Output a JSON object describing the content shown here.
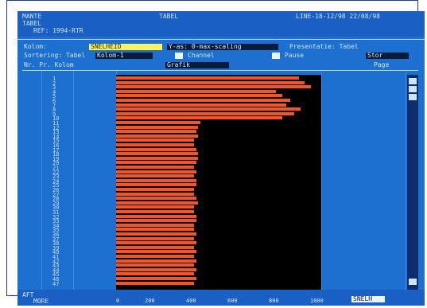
{
  "header": {
    "line1_left": "MANTE",
    "line1_mid": "TABEL",
    "line1_right": "LINE-18-12/98  22/08/98",
    "line2": "TABEL",
    "line3": "REF: 1994-RTR"
  },
  "controls": {
    "row1_label": "Kolom:",
    "row1_value": "SNELHEID",
    "row1_mid": "Y-as: 0-max-scaling",
    "row1_right": "Presentatie: Tabel",
    "row2_label": "Sortering: Tabel",
    "row2_value": "Kolom-1",
    "row2_checkbox1": "Channel",
    "row2_checkbox2": "Pause",
    "row2_right": "Stor",
    "row3_left": "Nr.  Pr.  Kolom",
    "row3_mid": "Grafik",
    "row3_right": "Page"
  },
  "chart_data": {
    "type": "bar",
    "orientation": "horizontal",
    "categories": [
      "1",
      "2",
      "3",
      "4",
      "5",
      "6",
      "7",
      "8",
      "9",
      "10",
      "11",
      "12",
      "13",
      "14",
      "15",
      "16",
      "17",
      "18",
      "19",
      "20",
      "21",
      "22",
      "23",
      "24",
      "25",
      "26",
      "27",
      "28",
      "29",
      "30",
      "31",
      "32",
      "33",
      "34",
      "35",
      "36",
      "37",
      "38",
      "39",
      "40",
      "41",
      "42",
      "43",
      "44",
      "45",
      "46",
      "47"
    ],
    "values": [
      8900,
      9200,
      9500,
      7800,
      8100,
      8500,
      8300,
      9000,
      8700,
      8100,
      4100,
      4000,
      3900,
      4000,
      3800,
      3800,
      3900,
      4000,
      4000,
      3900,
      3800,
      3900,
      3800,
      3900,
      3900,
      3800,
      3800,
      3900,
      4000,
      3800,
      3800,
      3900,
      3900,
      3800,
      3800,
      3900,
      3800,
      3900,
      3800,
      3900,
      3800,
      3900,
      3800,
      3900,
      3800,
      3900,
      3800
    ],
    "xlabel": "",
    "ylabel": "",
    "ticks": [
      "0",
      "200",
      "400",
      "600",
      "800",
      "1000"
    ]
  },
  "bottom": {
    "left1": "AFT",
    "left2": "MORE",
    "right_box": "SNELH"
  }
}
